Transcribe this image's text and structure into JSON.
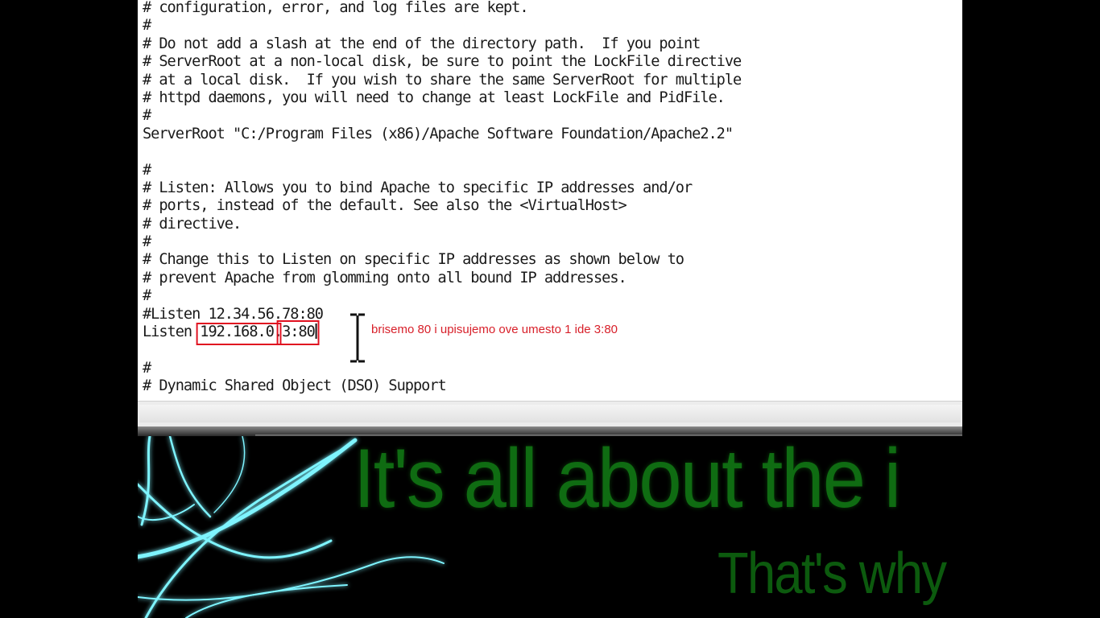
{
  "editor": {
    "lines": [
      "# configuration, error, and log files are kept.",
      "#",
      "# Do not add a slash at the end of the directory path.  If you point",
      "# ServerRoot at a non-local disk, be sure to point the LockFile directive",
      "# at a local disk.  If you wish to share the same ServerRoot for multiple",
      "# httpd daemons, you will need to change at least LockFile and PidFile.",
      "#",
      "ServerRoot \"C:/Program Files (x86)/Apache Software Foundation/Apache2.2\"",
      "",
      "#",
      "# Listen: Allows you to bind Apache to specific IP addresses and/or",
      "# ports, instead of the default. See also the <VirtualHost>",
      "# directive.",
      "#",
      "# Change this to Listen on specific IP addresses as shown below to",
      "# prevent Apache from glomming onto all bound IP addresses.",
      "#",
      "#Listen 12.34.56.78:80"
    ],
    "listen": {
      "keyword": "Listen ",
      "ip_prefix": "192.168.0.",
      "port_part": "3:80"
    },
    "lines_after": [
      "",
      "#",
      "# Dynamic Shared Object (DSO) Support"
    ]
  },
  "annotation": {
    "text": "brisemo 80 i upisujemo ove umesto 1 ide 3:80",
    "color": "#d8202a"
  },
  "wallpaper": {
    "headline": "It's all about the i",
    "subline": "That's why",
    "text_color": "#0f6c12",
    "accent_color": "#6ff3ff"
  }
}
